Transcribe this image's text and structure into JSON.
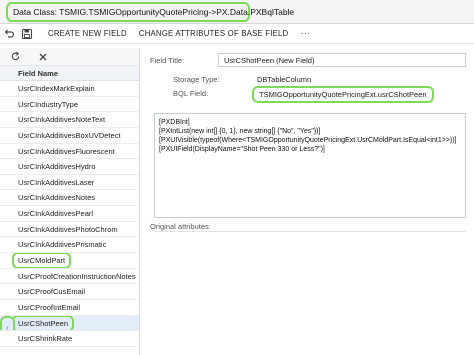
{
  "header": {
    "data_class": "Data Class: TSMIG.TSMIGOpportunityQuotePricing->PX.Data.PXBqlTable"
  },
  "toolbar": {
    "undo_icon": "undo-icon",
    "save_icon": "save-icon",
    "create_new_field": "CREATE NEW FIELD",
    "change_attributes": "CHANGE ATTRIBUTES OF BASE FIELD",
    "more": "···"
  },
  "field_list": {
    "header": "Field Name",
    "items": [
      "UsrCIndexMarkExplain",
      "UsrCIndustryType",
      "UsrCInkAdditivesNoteText",
      "UsrCInkAdditivesBoxUVDetect",
      "UsrCInkAdditivesFluorescent",
      "UsrCInkAdditivesHydro",
      "UsrCInkAdditivesLaser",
      "UsrCInkAdditivesNotes",
      "UsrCInkAdditivesPearl",
      "UsrCInkAdditivesPhotoChrom",
      "UsrCInkAdditivesPrismatic",
      "UsrCMoldPart",
      "UsrCProofCreationInstructionNotes",
      "UsrCProofCusEmail",
      "UsrCProofIntEmail",
      "UsrCShotPeen",
      "UsrCShrinkRate"
    ]
  },
  "detail": {
    "field_title_label": "Field Title:",
    "field_title_value": "UsrCShotPeen (New Field)",
    "storage_type_label": "Storage Type:",
    "storage_type_value": "DBTableColumn",
    "bql_field_label": "BQL Field:",
    "bql_field_value": "TSMIGOpportunityQuotePricingExt.usrCShotPeen",
    "code_lines": [
      "[PXDBInt]",
      "[PXIntList(new int[] {0, 1}, new string[] {\"No\", \"Yes\"})]",
      "[PXUIVisible(typeof(Where<TSMIGOpportunityQuotePricingExt.UsrCMoldPart.IsEqual<int1>>))]",
      "[PXUIField(DisplayName=\"Shot Peen 330 or Less?\")]"
    ],
    "original_attributes_label": "Original attributes:"
  }
}
